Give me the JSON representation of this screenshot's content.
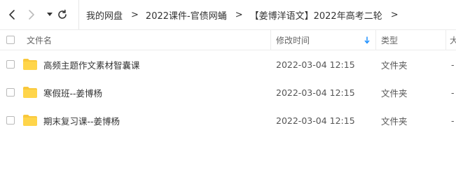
{
  "toolbar": {
    "back_icon": "chevron-left-icon",
    "forward_icon": "chevron-right-icon",
    "dropdown_icon": "caret-down-icon",
    "refresh_icon": "refresh-icon"
  },
  "breadcrumb": [
    "我的网盘",
    "2022课件-官债网蛹",
    "【姜博洋语文】2022年高考二轮"
  ],
  "breadcrumb_separator": ">",
  "columns": {
    "name": "文件名",
    "modified": "修改时间",
    "type": "类型",
    "size": "大"
  },
  "sort_icon": "sort-down-arrow-icon",
  "files": [
    {
      "name": "高频主题作文素材智囊课",
      "modified": "2022-03-04 12:15",
      "type": "文件夹",
      "size": "-"
    },
    {
      "name": "寒假班--姜博杨",
      "modified": "2022-03-04 12:15",
      "type": "文件夹",
      "size": "-"
    },
    {
      "name": "期末复习课--姜博杨",
      "modified": "2022-03-04 12:15",
      "type": "文件夹",
      "size": "-"
    }
  ],
  "colors": {
    "folder": "#f9c83c",
    "accent": "#1e90ff",
    "text": "#333333",
    "muted": "#666666"
  }
}
